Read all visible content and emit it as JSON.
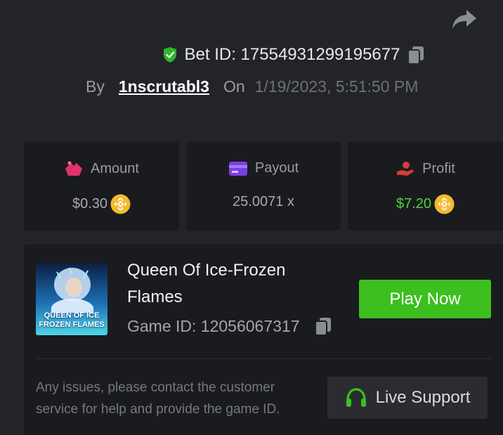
{
  "bet": {
    "label": "Bet ID: 17554931299195677",
    "by": "By",
    "user": "1nscrutabl3",
    "on": "On",
    "date": "1/19/2023, 5:51:50 PM"
  },
  "stats": {
    "amount": {
      "label": "Amount",
      "value": "$0.30"
    },
    "payout": {
      "label": "Payout",
      "value": "25.0071 x"
    },
    "profit": {
      "label": "Profit",
      "value": "$7.20"
    }
  },
  "game": {
    "thumb_line1": "QUEEN OF ICE",
    "thumb_line2": "FROZEN FLAMES",
    "name": "Queen Of Ice-Frozen Flames",
    "id_label": "Game ID: 12056067317",
    "play_label": "Play Now"
  },
  "support": {
    "help_text": "Any issues, please contact the customer service for help and provide the game ID.",
    "button_label": "Live Support"
  },
  "colors": {
    "background": "#232428",
    "panel": "#1a1b1f",
    "accent_green": "#3cbf1f",
    "profit_green": "#4bd53a",
    "amount_pink": "#e0336b",
    "payout_purple": "#7b3fe4",
    "profit_red": "#d63b3b",
    "coin_gold": "#f3ba2f"
  },
  "icons": {
    "share": "share-arrow-icon",
    "verified": "shield-check-icon",
    "copy": "copy-icon",
    "amount": "wallet-cash-icon",
    "payout": "credit-card-icon",
    "profit": "hand-coin-icon",
    "coin": "bnb-coin-icon",
    "support": "headphones-icon"
  }
}
